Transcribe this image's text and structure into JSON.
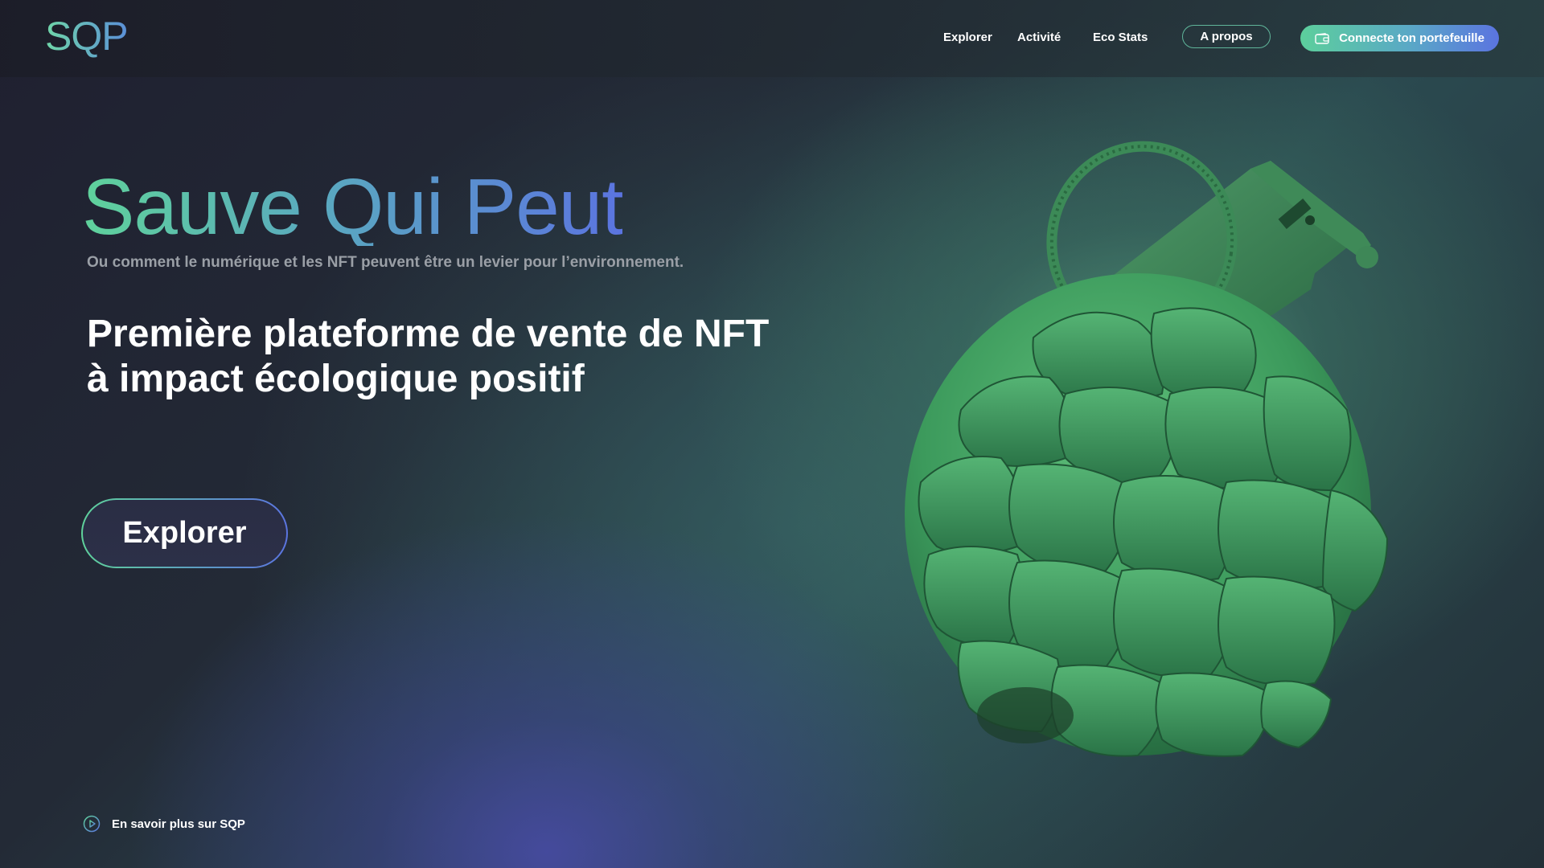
{
  "header": {
    "logo": "SQP",
    "nav": [
      {
        "label": "Explorer"
      },
      {
        "label": "Activité"
      },
      {
        "label": "Eco Stats"
      },
      {
        "label": "A propos"
      }
    ],
    "wallet_button": "Connecte ton portefeuille"
  },
  "hero": {
    "title": "Sauve Qui Peut",
    "subtitle": "Ou comment le numérique et les NFT peuvent être un levier pour l’environnement.",
    "heading_line1": "Première plateforme de vente de NFT",
    "heading_line2": "à impact écologique positif",
    "explore_button": "Explorer"
  },
  "footer": {
    "learn_more": "En savoir plus sur SQP"
  },
  "icons": {
    "wallet": "wallet-icon",
    "play": "play-circle-icon",
    "illustration": "artichoke-grenade-illustration"
  },
  "colors": {
    "accent_green": "#5fd29b",
    "accent_blue": "#5b74e0",
    "background_dark": "#1f2030"
  }
}
